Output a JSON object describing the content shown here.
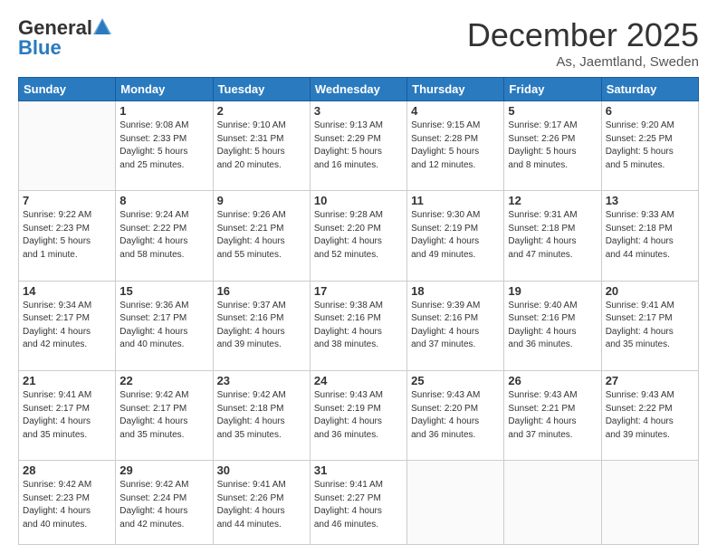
{
  "logo": {
    "general": "General",
    "blue": "Blue"
  },
  "header": {
    "month": "December 2025",
    "location": "As, Jaemtland, Sweden"
  },
  "days_of_week": [
    "Sunday",
    "Monday",
    "Tuesday",
    "Wednesday",
    "Thursday",
    "Friday",
    "Saturday"
  ],
  "weeks": [
    [
      {
        "day": "",
        "info": ""
      },
      {
        "day": "1",
        "info": "Sunrise: 9:08 AM\nSunset: 2:33 PM\nDaylight: 5 hours\nand 25 minutes."
      },
      {
        "day": "2",
        "info": "Sunrise: 9:10 AM\nSunset: 2:31 PM\nDaylight: 5 hours\nand 20 minutes."
      },
      {
        "day": "3",
        "info": "Sunrise: 9:13 AM\nSunset: 2:29 PM\nDaylight: 5 hours\nand 16 minutes."
      },
      {
        "day": "4",
        "info": "Sunrise: 9:15 AM\nSunset: 2:28 PM\nDaylight: 5 hours\nand 12 minutes."
      },
      {
        "day": "5",
        "info": "Sunrise: 9:17 AM\nSunset: 2:26 PM\nDaylight: 5 hours\nand 8 minutes."
      },
      {
        "day": "6",
        "info": "Sunrise: 9:20 AM\nSunset: 2:25 PM\nDaylight: 5 hours\nand 5 minutes."
      }
    ],
    [
      {
        "day": "7",
        "info": "Sunrise: 9:22 AM\nSunset: 2:23 PM\nDaylight: 5 hours\nand 1 minute."
      },
      {
        "day": "8",
        "info": "Sunrise: 9:24 AM\nSunset: 2:22 PM\nDaylight: 4 hours\nand 58 minutes."
      },
      {
        "day": "9",
        "info": "Sunrise: 9:26 AM\nSunset: 2:21 PM\nDaylight: 4 hours\nand 55 minutes."
      },
      {
        "day": "10",
        "info": "Sunrise: 9:28 AM\nSunset: 2:20 PM\nDaylight: 4 hours\nand 52 minutes."
      },
      {
        "day": "11",
        "info": "Sunrise: 9:30 AM\nSunset: 2:19 PM\nDaylight: 4 hours\nand 49 minutes."
      },
      {
        "day": "12",
        "info": "Sunrise: 9:31 AM\nSunset: 2:18 PM\nDaylight: 4 hours\nand 47 minutes."
      },
      {
        "day": "13",
        "info": "Sunrise: 9:33 AM\nSunset: 2:18 PM\nDaylight: 4 hours\nand 44 minutes."
      }
    ],
    [
      {
        "day": "14",
        "info": "Sunrise: 9:34 AM\nSunset: 2:17 PM\nDaylight: 4 hours\nand 42 minutes."
      },
      {
        "day": "15",
        "info": "Sunrise: 9:36 AM\nSunset: 2:17 PM\nDaylight: 4 hours\nand 40 minutes."
      },
      {
        "day": "16",
        "info": "Sunrise: 9:37 AM\nSunset: 2:16 PM\nDaylight: 4 hours\nand 39 minutes."
      },
      {
        "day": "17",
        "info": "Sunrise: 9:38 AM\nSunset: 2:16 PM\nDaylight: 4 hours\nand 38 minutes."
      },
      {
        "day": "18",
        "info": "Sunrise: 9:39 AM\nSunset: 2:16 PM\nDaylight: 4 hours\nand 37 minutes."
      },
      {
        "day": "19",
        "info": "Sunrise: 9:40 AM\nSunset: 2:16 PM\nDaylight: 4 hours\nand 36 minutes."
      },
      {
        "day": "20",
        "info": "Sunrise: 9:41 AM\nSunset: 2:17 PM\nDaylight: 4 hours\nand 35 minutes."
      }
    ],
    [
      {
        "day": "21",
        "info": "Sunrise: 9:41 AM\nSunset: 2:17 PM\nDaylight: 4 hours\nand 35 minutes."
      },
      {
        "day": "22",
        "info": "Sunrise: 9:42 AM\nSunset: 2:17 PM\nDaylight: 4 hours\nand 35 minutes."
      },
      {
        "day": "23",
        "info": "Sunrise: 9:42 AM\nSunset: 2:18 PM\nDaylight: 4 hours\nand 35 minutes."
      },
      {
        "day": "24",
        "info": "Sunrise: 9:43 AM\nSunset: 2:19 PM\nDaylight: 4 hours\nand 36 minutes."
      },
      {
        "day": "25",
        "info": "Sunrise: 9:43 AM\nSunset: 2:20 PM\nDaylight: 4 hours\nand 36 minutes."
      },
      {
        "day": "26",
        "info": "Sunrise: 9:43 AM\nSunset: 2:21 PM\nDaylight: 4 hours\nand 37 minutes."
      },
      {
        "day": "27",
        "info": "Sunrise: 9:43 AM\nSunset: 2:22 PM\nDaylight: 4 hours\nand 39 minutes."
      }
    ],
    [
      {
        "day": "28",
        "info": "Sunrise: 9:42 AM\nSunset: 2:23 PM\nDaylight: 4 hours\nand 40 minutes."
      },
      {
        "day": "29",
        "info": "Sunrise: 9:42 AM\nSunset: 2:24 PM\nDaylight: 4 hours\nand 42 minutes."
      },
      {
        "day": "30",
        "info": "Sunrise: 9:41 AM\nSunset: 2:26 PM\nDaylight: 4 hours\nand 44 minutes."
      },
      {
        "day": "31",
        "info": "Sunrise: 9:41 AM\nSunset: 2:27 PM\nDaylight: 4 hours\nand 46 minutes."
      },
      {
        "day": "",
        "info": ""
      },
      {
        "day": "",
        "info": ""
      },
      {
        "day": "",
        "info": ""
      }
    ]
  ]
}
